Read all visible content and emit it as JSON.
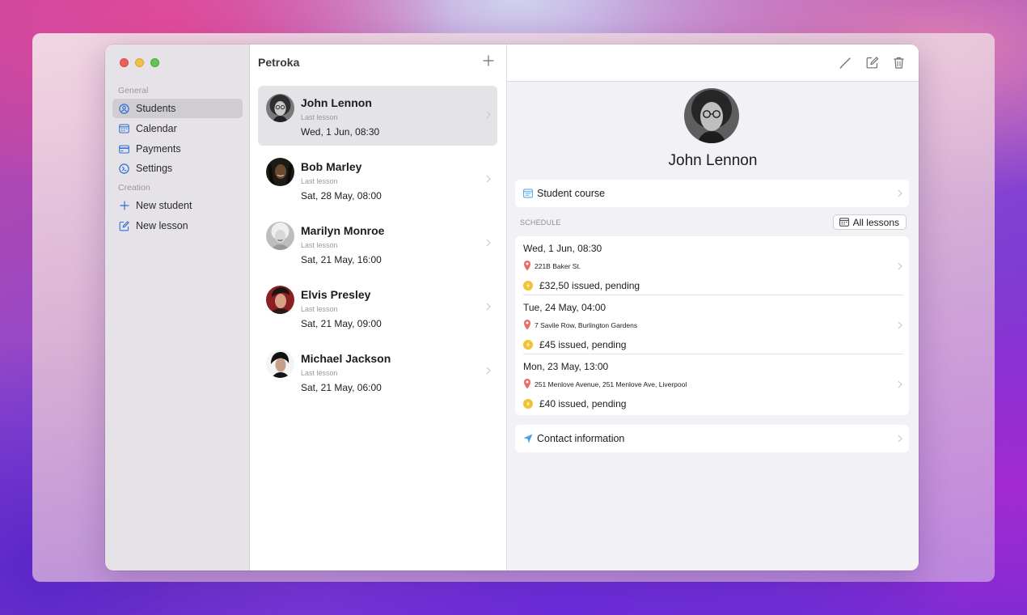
{
  "app": {
    "title": "Petroka"
  },
  "sidebar": {
    "sections": [
      {
        "label": "General"
      },
      {
        "label": "Creation"
      }
    ],
    "items": [
      {
        "label": "Students",
        "icon": "person-circle-icon"
      },
      {
        "label": "Calendar",
        "icon": "calendar-icon"
      },
      {
        "label": "Payments",
        "icon": "credit-card-icon"
      },
      {
        "label": "Settings",
        "icon": "gear-circle-icon"
      },
      {
        "label": "New student",
        "icon": "plus-icon"
      },
      {
        "label": "New lesson",
        "icon": "compose-icon"
      }
    ]
  },
  "students": [
    {
      "name": "John Lennon",
      "sub": "Last lesson",
      "date": "Wed, 1 Jun, 08:30"
    },
    {
      "name": "Bob Marley",
      "sub": "Last lesson",
      "date": "Sat, 28 May, 08:00"
    },
    {
      "name": "Marilyn Monroe",
      "sub": "Last lesson",
      "date": "Sat, 21 May, 16:00"
    },
    {
      "name": "Elvis Presley",
      "sub": "Last lesson",
      "date": "Sat, 21 May, 09:00"
    },
    {
      "name": "Michael Jackson",
      "sub": "Last lesson",
      "date": "Sat, 21 May, 06:00"
    }
  ],
  "detail": {
    "name": "John Lennon",
    "course_label": "Student course",
    "schedule_label": "SCHEDULE",
    "all_lessons_label": "All lessons",
    "lessons": [
      {
        "date": "Wed, 1 Jun, 08:30",
        "address": "221B Baker St.",
        "payment": "£32,50 issued, pending"
      },
      {
        "date": "Tue, 24 May, 04:00",
        "address": "7 Savile Row, Burlington Gardens",
        "payment": "£45 issued, pending"
      },
      {
        "date": "Mon, 23 May, 13:00",
        "address": "251 Menlove Avenue, 251 Menlove Ave, Liverpool",
        "payment": "£40 issued, pending"
      }
    ],
    "contact_label": "Contact information"
  },
  "colors": {
    "accent": "#2f6fd6",
    "pin": "#e46f6a",
    "coin": "#f2c22f",
    "send": "#4aa3e0"
  }
}
